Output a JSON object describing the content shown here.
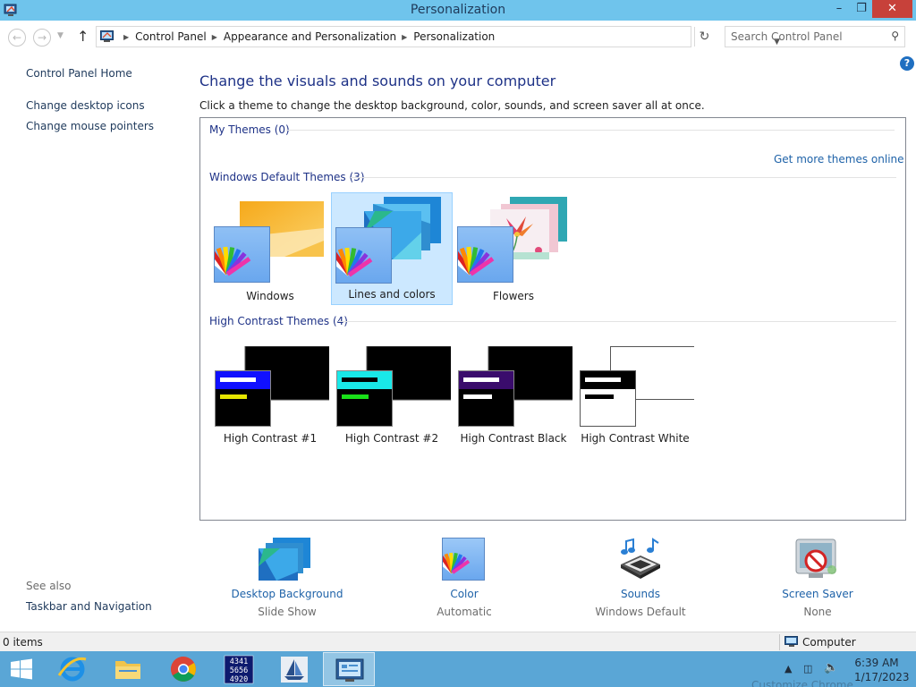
{
  "window": {
    "title": "Personalization"
  },
  "address": {
    "breadcrumbs": [
      "Control Panel",
      "Appearance and Personalization",
      "Personalization"
    ],
    "search_placeholder": "Search Control Panel"
  },
  "left_pane": {
    "links": [
      "Control Panel Home",
      "Change desktop icons",
      "Change mouse pointers"
    ],
    "see_also_label": "See also",
    "see_also_links": [
      "Taskbar and Navigation"
    ]
  },
  "main": {
    "heading": "Change the visuals and sounds on your computer",
    "subtext": "Click a theme to change the desktop background, color, sounds, and screen saver all at once.",
    "my_themes": "My Themes (0)",
    "get_more_link": "Get more themes online",
    "default_group": "Windows Default Themes (3)",
    "default_themes": [
      "Windows",
      "Lines and colors",
      "Flowers"
    ],
    "selected_theme": "Lines and colors",
    "hc_group": "High Contrast Themes (4)",
    "hc_themes": [
      "High Contrast #1",
      "High Contrast #2",
      "High Contrast Black",
      "High Contrast White"
    ]
  },
  "options": [
    {
      "label": "Desktop Background",
      "value": "Slide Show",
      "icon": "desktop-background-icon"
    },
    {
      "label": "Color",
      "value": "Automatic",
      "icon": "color-palette-icon"
    },
    {
      "label": "Sounds",
      "value": "Windows Default",
      "icon": "sounds-icon"
    },
    {
      "label": "Screen Saver",
      "value": "None",
      "icon": "screen-saver-icon"
    }
  ],
  "status": {
    "items": "0 items",
    "location": "Computer"
  },
  "taskbar": {
    "time": "6:39 AM",
    "date": "1/17/2023",
    "hint": "Customize Chrome",
    "calc_display": "4341\n5656\n4920"
  },
  "colors": {
    "titlebar": "#6fc4ec",
    "taskbar": "#5aa6d6",
    "link": "#1e62a8",
    "heading": "#1e3287",
    "selected_theme_bg": "#cce8ff"
  }
}
